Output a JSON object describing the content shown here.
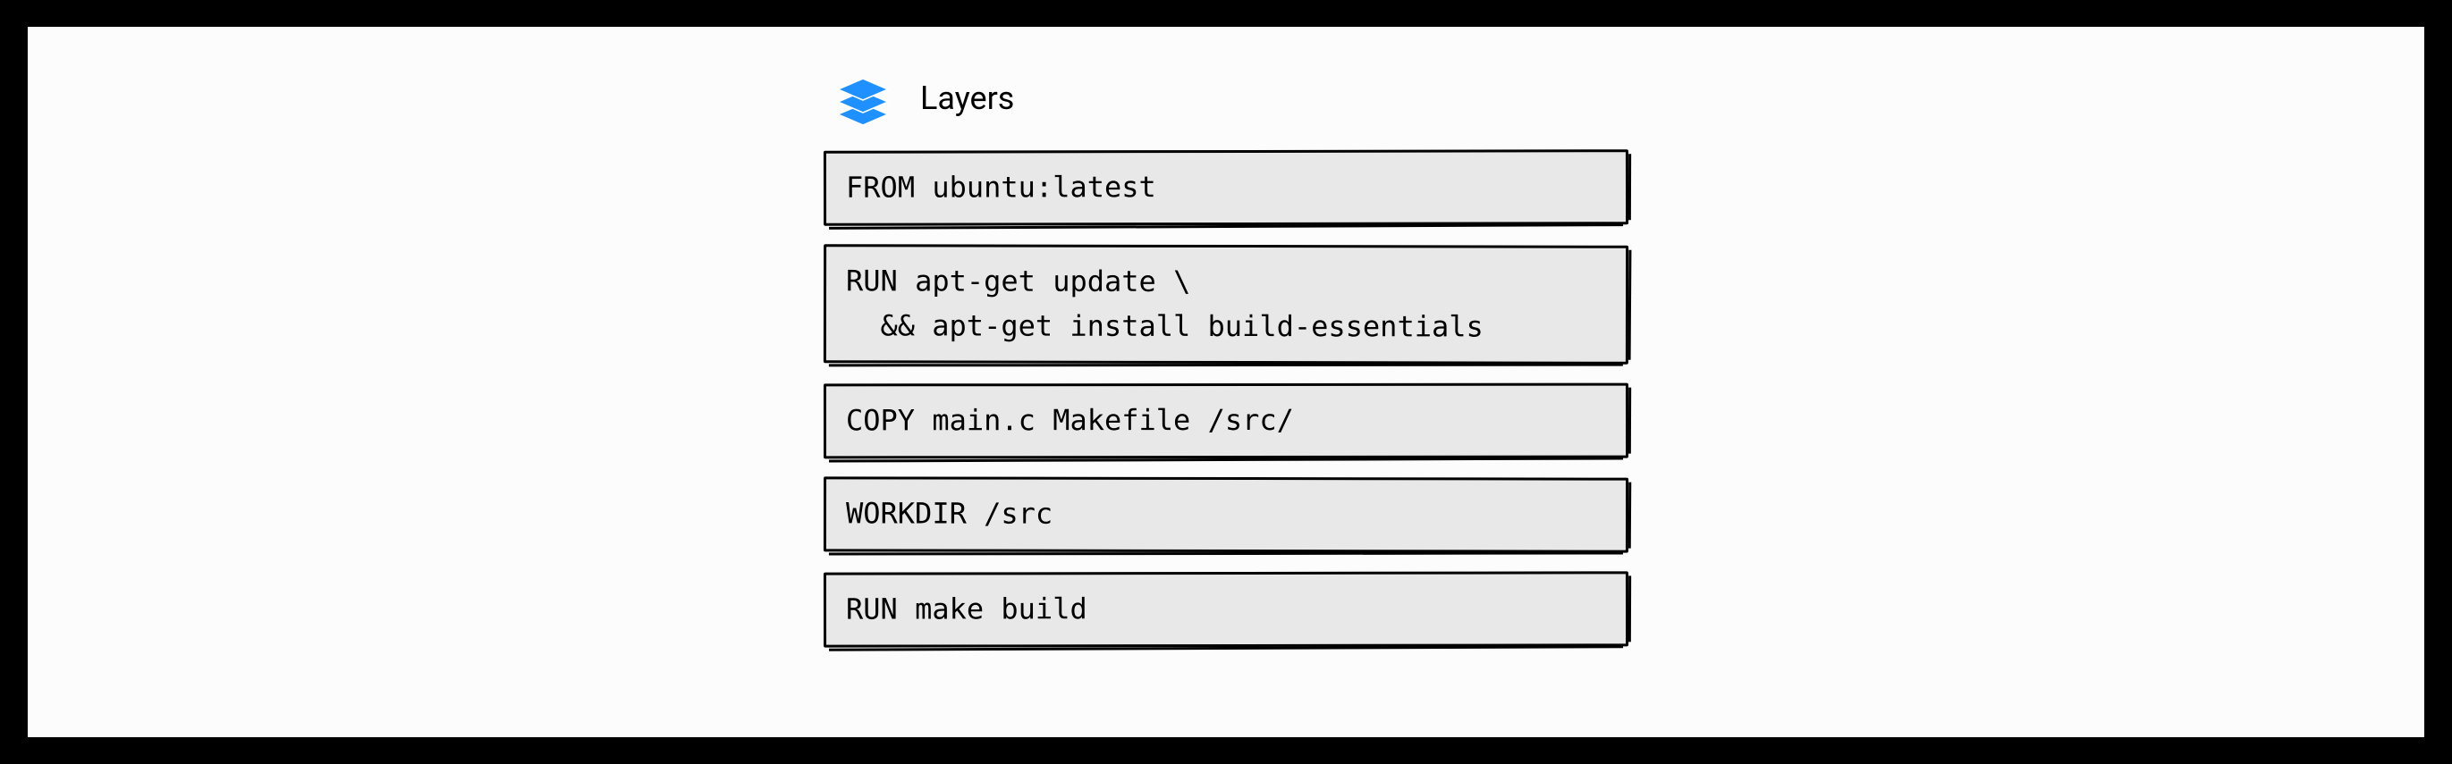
{
  "title": "Layers",
  "layers": [
    "FROM ubuntu:latest",
    "RUN apt-get update \\\n  && apt-get install build-essentials",
    "COPY main.c Makefile /src/",
    "WORKDIR /src",
    "RUN make build"
  ],
  "colors": {
    "icon": "#1e90ff",
    "box_bg": "#e8e8e8",
    "box_border": "#000000",
    "page_bg": "#fcfcfc"
  }
}
